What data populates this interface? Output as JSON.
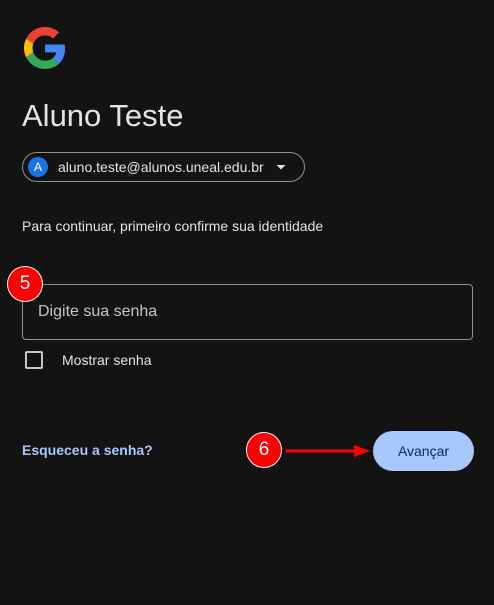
{
  "logo": {
    "icon": "google-g-icon"
  },
  "header": {
    "title": "Aluno Teste"
  },
  "account": {
    "avatar_letter": "A",
    "email": "aluno.teste@alunos.uneal.edu.br",
    "dropdown_icon": "caret-down-icon"
  },
  "subtitle": "Para continuar, primeiro confirme sua identidade",
  "password": {
    "placeholder": "Digite sua senha",
    "value": ""
  },
  "show_password": {
    "label": "Mostrar senha",
    "checked": false
  },
  "forgot_password": {
    "label": "Esqueceu a senha?"
  },
  "next_button": {
    "label": "Avançar"
  },
  "annotations": {
    "marker_1": "5",
    "marker_2": "6"
  },
  "colors": {
    "background": "#131314",
    "accent": "#a8c7fa",
    "avatar": "#1a73e8",
    "marker": "#ff0000"
  }
}
